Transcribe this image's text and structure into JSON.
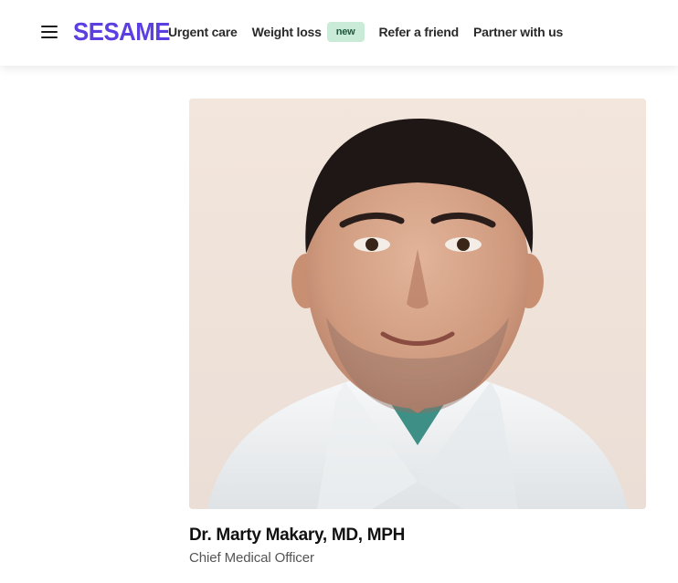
{
  "header": {
    "logo_text": "SESAME",
    "menu_icon": "hamburger-icon",
    "nav": [
      {
        "label": "Urgent care"
      },
      {
        "label": "Weight loss",
        "badge": "new"
      },
      {
        "label": "Refer a friend"
      },
      {
        "label": "Partner with us"
      }
    ]
  },
  "profile": {
    "name": "Dr. Marty Makary, MD, MPH",
    "title": "Chief Medical Officer",
    "photo_alt": "Portrait photo"
  },
  "colors": {
    "brand": "#5b3fe0",
    "badge_bg": "#c9ebd8",
    "badge_text": "#1d5a3a",
    "photo_bg": "#f0e3d8"
  }
}
